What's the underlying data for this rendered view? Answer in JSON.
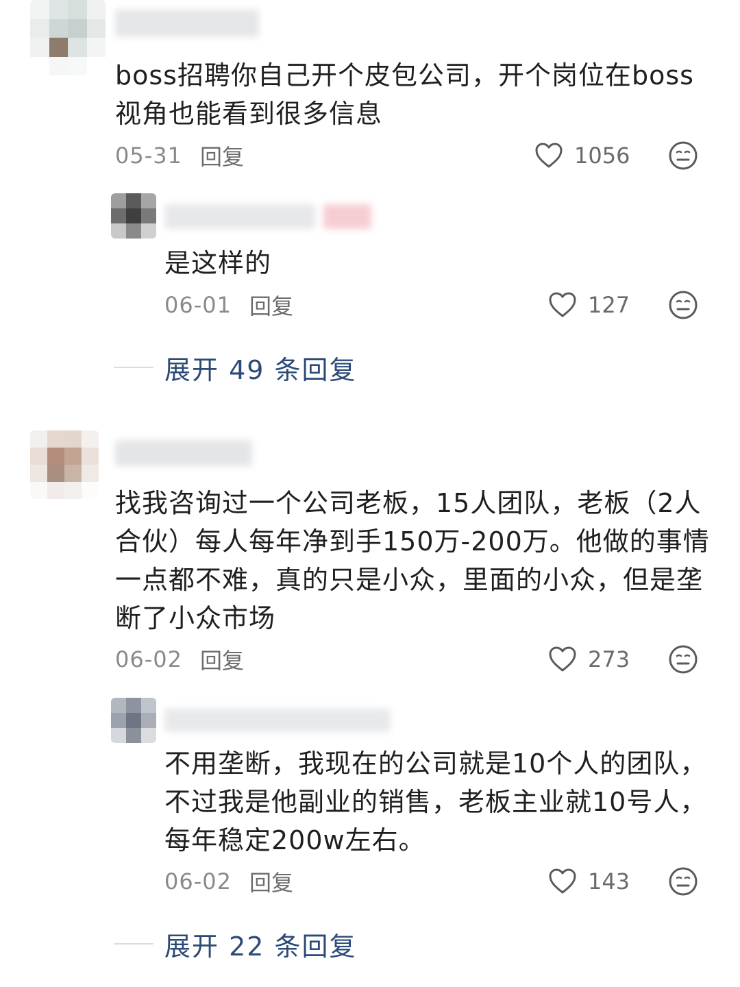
{
  "comments": [
    {
      "text": "boss招聘你自己开个皮包公司，开个岗位在boss视角也能看到很多信息",
      "date": "05-31",
      "reply_label": "回复",
      "likes": "1056",
      "replies": [
        {
          "text": "是这样的",
          "date": "06-01",
          "reply_label": "回复",
          "likes": "127"
        }
      ],
      "expand_label": "展开 49 条回复"
    },
    {
      "text": "找我咨询过一个公司老板，15人团队，老板（2人合伙）每人每年净到手150万-200万。他做的事情一点都不难，真的只是小众，里面的小众，但是垄断了小众市场",
      "date": "06-02",
      "reply_label": "回复",
      "likes": "273",
      "replies": [
        {
          "text": "不用垄断，我现在的公司就是10个人的团队，不过我是他副业的销售，老板主业就10号人，每年稳定200w左右。",
          "date": "06-02",
          "reply_label": "回复",
          "likes": "143"
        }
      ],
      "expand_label": "展开 22 条回复"
    }
  ],
  "colors": {
    "expand_link": "#2b4a78",
    "meta_text": "#8a8a8a",
    "body_text": "#1f1f1f"
  },
  "icons": {
    "like": "heart-outline-icon",
    "dislike": "neutral-face-icon"
  }
}
